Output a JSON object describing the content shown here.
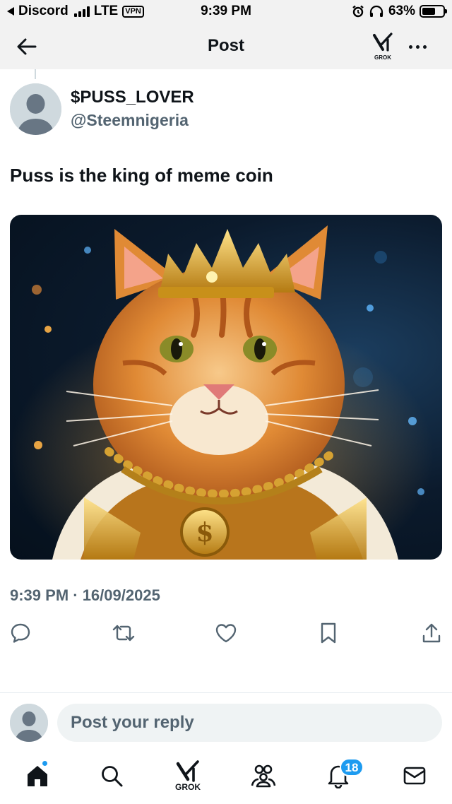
{
  "status_bar": {
    "back_app": "Discord",
    "network": "LTE",
    "vpn": "VPN",
    "time": "9:39 PM",
    "battery_percent": "63%",
    "battery_level": 0.63
  },
  "header": {
    "title": "Post",
    "grok_label": "GROK",
    "icons": [
      "arrow-left-icon",
      "grok-icon",
      "more-icon"
    ]
  },
  "post": {
    "display_name": "$PUSS_LOVER",
    "handle": "@Steemnigeria",
    "text": "Puss is the king of meme coin",
    "image_alt": "crowned-orange-cat-illustration",
    "timestamp": "9:39 PM · 16/09/2025"
  },
  "actions": [
    "reply-icon",
    "repost-icon",
    "like-icon",
    "bookmark-icon",
    "share-icon"
  ],
  "reply": {
    "placeholder": "Post your reply"
  },
  "bottom_nav": {
    "items": [
      "home-icon",
      "search-icon",
      "grok-icon",
      "communities-icon",
      "notifications-icon",
      "messages-icon"
    ],
    "grok_label": "GROK",
    "notifications_count": "18"
  },
  "colors": {
    "accent": "#1d9bf0",
    "text_primary": "#0f1419",
    "text_secondary": "#536471",
    "bar_background": "#f2f2f2"
  }
}
